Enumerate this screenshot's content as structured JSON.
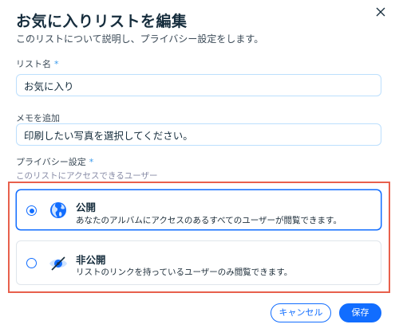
{
  "dialog": {
    "title": "お気に入りリストを編集",
    "subtitle": "このリストについて説明し、プライバシー設定をします。"
  },
  "fields": {
    "list_name": {
      "label": "リスト名",
      "required_mark": "*",
      "value": "お気に入り"
    },
    "memo": {
      "label": "メモを追加",
      "value": "印刷したい写真を選択してください。"
    }
  },
  "privacy": {
    "label": "プライバシー設定",
    "required_mark": "*",
    "hint": "このリストにアクセスできるユーザー",
    "options": [
      {
        "title": "公開",
        "description": "あなたのアルバムにアクセスのあるすべてのユーザーが閲覧できます。",
        "selected": true,
        "icon": "globe-icon"
      },
      {
        "title": "非公開",
        "description": "リストのリンクを持っているユーザーのみ閲覧できます。",
        "selected": false,
        "icon": "eye-off-icon"
      }
    ]
  },
  "buttons": {
    "cancel": "キャンセル",
    "save": "保存"
  },
  "colors": {
    "accent": "#116dff",
    "highlight": "#e8604c",
    "title": "#162d3d"
  }
}
